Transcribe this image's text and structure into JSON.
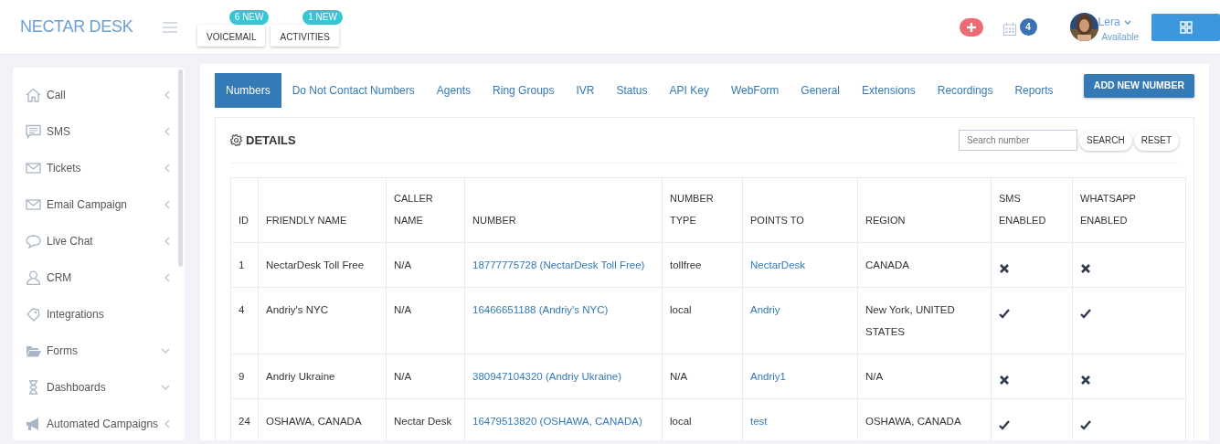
{
  "header": {
    "logo": "NECTAR DESK",
    "buttons": [
      {
        "label": "VOICEMAIL",
        "badge": "6 NEW"
      },
      {
        "label": "ACTIVITIES",
        "badge": "1 NEW"
      }
    ],
    "calendar_badge": "4",
    "user": {
      "name": "Lera",
      "status": "Available"
    }
  },
  "sidebar": {
    "items": [
      {
        "label": "Call",
        "kind": "submenu"
      },
      {
        "label": "SMS",
        "kind": "submenu"
      },
      {
        "label": "Tickets",
        "kind": "submenu"
      },
      {
        "label": "Email Campaign",
        "kind": "submenu"
      },
      {
        "label": "Live Chat",
        "kind": "submenu"
      },
      {
        "label": "CRM",
        "kind": "submenu"
      },
      {
        "label": "Integrations",
        "kind": "link"
      },
      {
        "label": "Forms",
        "kind": "dropdown"
      },
      {
        "label": "Dashboards",
        "kind": "dropdown"
      },
      {
        "label": "Automated Campaigns",
        "kind": "submenu"
      }
    ]
  },
  "tabs": [
    {
      "label": "Numbers",
      "selected": true
    },
    {
      "label": "Do Not Contact Numbers",
      "selected": false
    },
    {
      "label": "Agents",
      "selected": false
    },
    {
      "label": "Ring Groups",
      "selected": false
    },
    {
      "label": "IVR",
      "selected": false
    },
    {
      "label": "Status",
      "selected": false
    },
    {
      "label": "API Key",
      "selected": false
    },
    {
      "label": "WebForm",
      "selected": false
    },
    {
      "label": "General",
      "selected": false
    },
    {
      "label": "Extensions",
      "selected": false
    },
    {
      "label": "Recordings",
      "selected": false
    },
    {
      "label": "Reports",
      "selected": false
    }
  ],
  "add_button": "ADD NEW NUMBER",
  "details": {
    "title": "DETAILS",
    "search": {
      "placeholder": "Search number"
    },
    "buttons": [
      "SEARCH",
      "RESET"
    ]
  },
  "table": {
    "columns": [
      "ID",
      "FRIENDLY NAME",
      "CALLER NAME",
      "NUMBER",
      "NUMBER TYPE",
      "POINTS TO",
      "REGION",
      "SMS ENABLED",
      "WHATSAPP ENABLED"
    ],
    "rows": [
      {
        "id": "1",
        "friendly_name": "NectarDesk Toll Free",
        "caller_name": "N/A",
        "number": "18777775728 (NectarDesk Toll Free)",
        "number_type": "tollfree",
        "points_to": "NectarDesk",
        "region": "CANADA",
        "sms_enabled": false,
        "whatsapp_enabled": false
      },
      {
        "id": "4",
        "friendly_name": "Andriy's NYC",
        "caller_name": "N/A",
        "number": "16466651188 (Andriy's NYC)",
        "number_type": "local",
        "points_to": "Andriy",
        "region": "New York, UNITED STATES",
        "sms_enabled": true,
        "whatsapp_enabled": true
      },
      {
        "id": "9",
        "friendly_name": "Andriy Ukraine",
        "caller_name": "N/A",
        "number": "380947104320 (Andriy Ukraine)",
        "number_type": "N/A",
        "points_to": "Andriy1",
        "region": "N/A",
        "sms_enabled": false,
        "whatsapp_enabled": false
      },
      {
        "id": "24",
        "friendly_name": "OSHAWA, CANADA",
        "caller_name": "Nectar Desk",
        "number": "16479513820 (OSHAWA, CANADA)",
        "number_type": "local",
        "points_to": "test",
        "region": "OSHAWA, CANADA",
        "sms_enabled": true,
        "whatsapp_enabled": true
      }
    ]
  }
}
